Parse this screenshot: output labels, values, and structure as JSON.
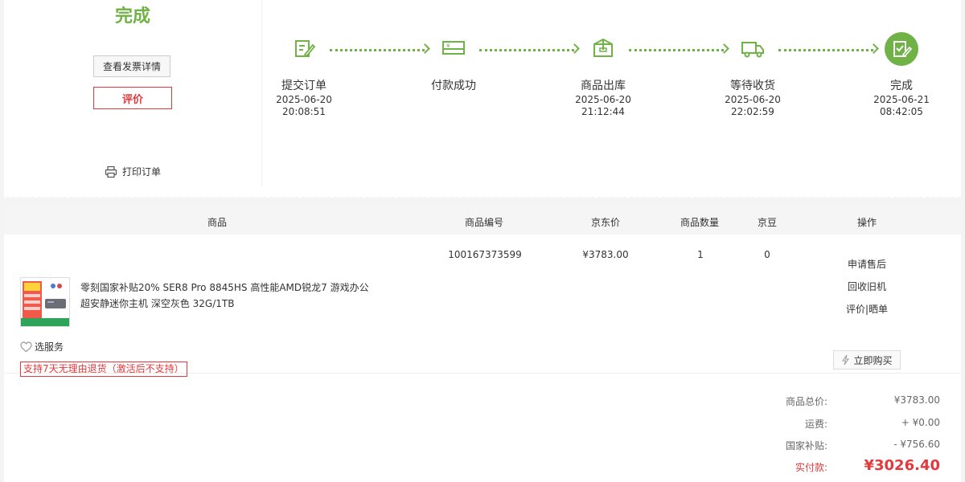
{
  "order_status": "完成",
  "actions": {
    "invoice_label": "查看发票详情",
    "rate_label": "评价",
    "print_label": "打印订单"
  },
  "steps": [
    {
      "name": "提交订单",
      "date": "2025-06-20",
      "time": "20:08:51",
      "icon": "edit-icon"
    },
    {
      "name": "付款成功",
      "date": "",
      "time": "",
      "icon": "payment-card-icon"
    },
    {
      "name": "商品出库",
      "date": "2025-06-20",
      "time": "21:12:44",
      "icon": "package-icon"
    },
    {
      "name": "等待收货",
      "date": "2025-06-20",
      "time": "22:02:59",
      "icon": "truck-icon"
    },
    {
      "name": "完成",
      "date": "2025-06-21",
      "time": "08:42:05",
      "icon": "complete-icon"
    }
  ],
  "table": {
    "headers": {
      "product": "商品",
      "sku": "商品编号",
      "price": "京东价",
      "qty": "商品数量",
      "beans": "京豆",
      "ops": "操作"
    },
    "item": {
      "title": "零刻国家补贴20% SER8 Pro 8845HS 高性能AMD锐龙7 游戏办公超安静迷你主机 深空灰色 32G/1TB",
      "sku": "100167373599",
      "price": "¥3783.00",
      "qty": "1",
      "beans": "0",
      "service_label": "选服务",
      "return_tag": "支持7天无理由退货（激活后不支持）",
      "ops": {
        "after_sale": "申请售后",
        "recycle": "回收旧机",
        "review": "评价|晒单",
        "buy_again": "立即购买"
      }
    }
  },
  "summary": {
    "total_label": "商品总价:",
    "total": "¥3783.00",
    "shipping_label": "运费:",
    "shipping": "+ ¥0.00",
    "subsidy_label": "国家补贴:",
    "subsidy": "- ¥756.60",
    "paid_label": "实付款:",
    "paid": "¥3026.40"
  },
  "colors": {
    "accent_green": "#71b247",
    "accent_red": "#e4393c"
  }
}
